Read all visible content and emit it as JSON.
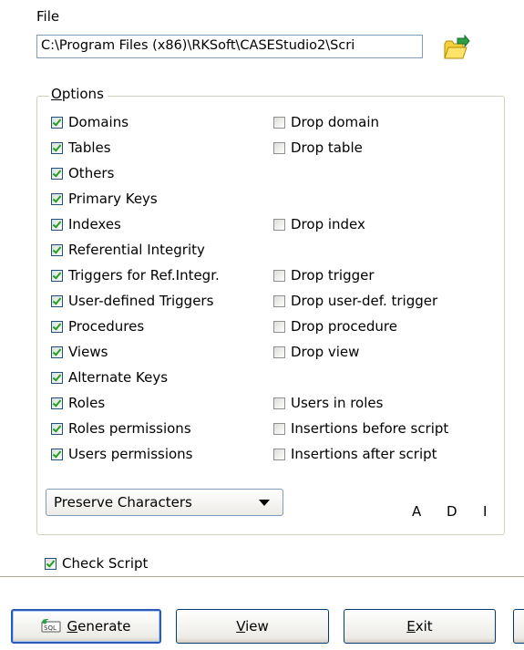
{
  "file": {
    "label": "File",
    "path": "C:\\Program Files (x86)\\RKSoft\\CASEStudio2\\Scri",
    "browse_icon": "folder-open-icon"
  },
  "options": {
    "legend": "Options",
    "left_column": [
      {
        "label": "Domains",
        "checked": true
      },
      {
        "label": "Tables",
        "checked": true
      },
      {
        "label": "Others",
        "checked": true
      },
      {
        "label": "Primary Keys",
        "checked": true
      },
      {
        "label": "Indexes",
        "checked": true
      },
      {
        "label": "Referential Integrity",
        "checked": true
      },
      {
        "label": "Triggers for Ref.Integr.",
        "checked": true
      },
      {
        "label": "User-defined Triggers",
        "checked": true
      },
      {
        "label": "Procedures",
        "checked": true
      },
      {
        "label": "Views",
        "checked": true
      },
      {
        "label": "Alternate Keys",
        "checked": true
      },
      {
        "label": "Roles",
        "checked": true
      },
      {
        "label": "Roles permissions",
        "checked": true
      },
      {
        "label": "Users permissions",
        "checked": true
      }
    ],
    "right_column": [
      {
        "label": "Drop domain",
        "checked": false
      },
      {
        "label": "Drop table",
        "checked": false
      },
      {
        "label": "Drop index",
        "checked": false
      },
      {
        "label": "Drop trigger",
        "checked": false
      },
      {
        "label": "Drop user-def. trigger",
        "checked": false
      },
      {
        "label": "Drop procedure",
        "checked": false
      },
      {
        "label": "Drop view",
        "checked": false
      },
      {
        "label": "Users in roles",
        "checked": false
      },
      {
        "label": "Insertions before script",
        "checked": false
      },
      {
        "label": "Insertions after script",
        "checked": false
      }
    ],
    "case_select": "Preserve Characters",
    "case_letters": [
      "A",
      "D",
      "I"
    ]
  },
  "check_script": {
    "label": "Check Script",
    "checked": true
  },
  "buttons": {
    "generate": {
      "label": "Generate",
      "icon": "sql-generate-icon"
    },
    "view": {
      "label": "View"
    },
    "exit": {
      "label": "Exit"
    }
  },
  "colors": {
    "check_mark": "#21a121",
    "default_button_border": "#2b5bb5",
    "input_border": "#7f9db9"
  }
}
